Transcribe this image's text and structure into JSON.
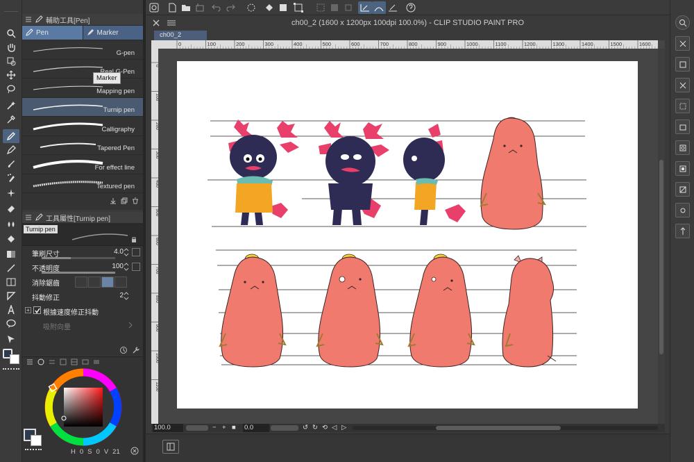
{
  "window": {
    "title": "ch00_2 (1600 x 1200px 100dpi 100.0%)  - CLIP STUDIO PAINT PRO"
  },
  "document_tab": {
    "label": "ch00_2"
  },
  "sub_tool_panel": {
    "title": "輔助工具[Pen]",
    "tabs": [
      {
        "label": "Pen"
      },
      {
        "label": "Marker"
      }
    ],
    "tooltip": "Marker",
    "brushes": [
      {
        "label": "G-pen"
      },
      {
        "label": "Real G-Pen"
      },
      {
        "label": "Mapping pen"
      },
      {
        "label": "Turnip pen",
        "selected": true
      },
      {
        "label": "Calligraphy"
      },
      {
        "label": "Tapered Pen"
      },
      {
        "label": "For effect line"
      },
      {
        "label": "Textured pen"
      }
    ]
  },
  "tool_property": {
    "title": "工具屬性[Turnip pen]",
    "preview_label": "Turnip pen",
    "brush_size": {
      "label": "筆刷尺寸",
      "value": "4.0"
    },
    "opacity": {
      "label": "不透明度",
      "value": "100"
    },
    "anti_alias": {
      "label": "消除鋸齒"
    },
    "stabilization": {
      "label": "抖動修正",
      "value": "2"
    },
    "speed_stabilize": {
      "label": "根據速度修正抖動",
      "checked": true
    },
    "snap": {
      "label": "吸附向量"
    }
  },
  "color_panel": {
    "readout": {
      "h": "0",
      "s": "0",
      "v": "21"
    },
    "readout_labels": {
      "h": "H",
      "s": "S",
      "v": "V"
    }
  },
  "rulers": {
    "top_ticks": [
      "0",
      "100",
      "200",
      "300",
      "400",
      "500",
      "600",
      "700",
      "800",
      "900",
      "1000",
      "1100",
      "1200",
      "1300",
      "1400",
      "1500",
      "1600"
    ],
    "left_ticks": [
      "0",
      "100",
      "200",
      "300",
      "400",
      "500",
      "600",
      "700",
      "800",
      "900",
      "1000",
      "1100"
    ]
  },
  "zoom_bar": {
    "zoom": "100.0",
    "rotation": "0.0"
  },
  "colors": {
    "accent": "#4d6480",
    "tab_active": "#5a7aa3",
    "ui_bg": "#333333",
    "axolotl_body": "#2e2b55",
    "axolotl_gills": "#e8406a",
    "coat": "#f2a623",
    "scarf": "#6bbcb0",
    "capybara": "#f07a6e",
    "capybara_outline": "#3a2222",
    "citrus": "#f4d23a"
  },
  "icons": {
    "tools": [
      "zoom-icon",
      "hand-icon",
      "rotate-icon",
      "move-icon",
      "lasso-icon",
      "magic-wand-icon",
      "eyedropper-icon",
      "pen-icon",
      "pencil-icon",
      "brush-icon",
      "airbrush-icon",
      "decoration-icon",
      "eraser-icon",
      "blend-icon",
      "fill-icon",
      "gradient-icon",
      "figure-icon",
      "frame-icon",
      "ruler-icon",
      "text-icon",
      "balloon-icon",
      "correct-line-icon"
    ]
  }
}
